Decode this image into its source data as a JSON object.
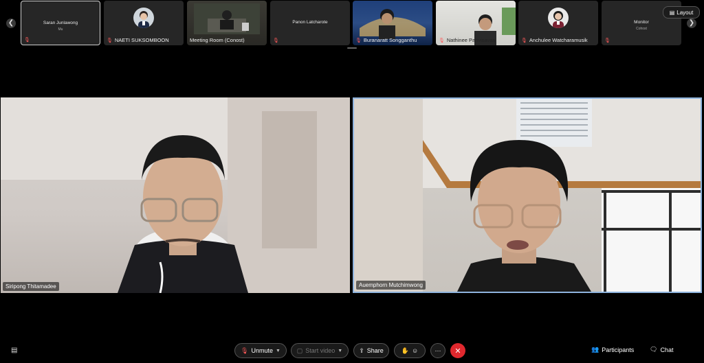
{
  "participants_strip": [
    {
      "name": "Saran Junlawong",
      "sub": "Mu",
      "type": "name-only"
    },
    {
      "name": "NAETI SUKSOMBOON",
      "type": "avatar"
    },
    {
      "name": "Meeting Room (Conost)",
      "type": "video"
    },
    {
      "name": "Panon Latcharote",
      "type": "name-only"
    },
    {
      "name": "Buranaratt Songganthu",
      "type": "video"
    },
    {
      "name": "Nathinee Panvisavas",
      "type": "video"
    },
    {
      "name": "Anchulee Watcharamusik",
      "type": "avatar"
    },
    {
      "name": "Monitor",
      "sub": "Cohost",
      "type": "name-only"
    }
  ],
  "layout_label": "Layout",
  "main_tiles": [
    {
      "name": "Siripong Thitamadee"
    },
    {
      "name": "Auemphorn Mutchimwong"
    }
  ],
  "toolbar": {
    "unmute": "Unmute",
    "start_video": "Start video",
    "share": "Share",
    "participants": "Participants",
    "chat": "Chat"
  },
  "colors": {
    "end_call": "#e0282e",
    "active_speaker_border": "#8fb4de",
    "mic_muted": "#ff5a5a"
  }
}
